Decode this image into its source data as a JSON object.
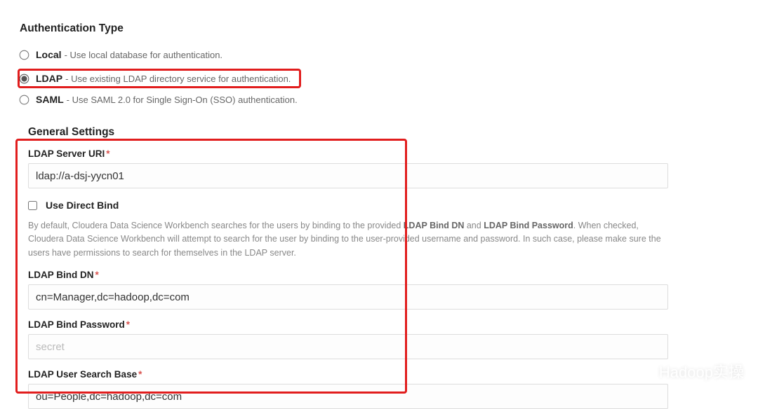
{
  "auth": {
    "title": "Authentication Type",
    "options": {
      "local": {
        "label": "Local",
        "desc": " - Use local database for authentication."
      },
      "ldap": {
        "label": "LDAP",
        "desc": " - Use existing LDAP directory service for authentication."
      },
      "saml": {
        "label": "SAML",
        "desc": " - Use SAML 2.0 for Single Sign-On (SSO) authentication."
      }
    },
    "selected": "ldap"
  },
  "general": {
    "title": "General Settings",
    "ldap_server_uri": {
      "label": "LDAP Server URI",
      "value": "ldap://a-dsj-yycn01",
      "required": true
    },
    "use_direct_bind": {
      "label": "Use Direct Bind",
      "checked": false
    },
    "help": {
      "p1": "By default, Cloudera Data Science Workbench searches for the users by binding to the provided ",
      "s1": "LDAP Bind DN",
      "p2": " and ",
      "s2": "LDAP Bind Password",
      "p3": ". When checked, Cloudera Data Science Workbench will attempt to search for the user by binding to the user-provided username and password. In such case, please make sure the users have permissions to search for themselves in the LDAP server."
    },
    "ldap_bind_dn": {
      "label": "LDAP Bind DN",
      "value": "cn=Manager,dc=hadoop,dc=com",
      "required": true
    },
    "ldap_bind_password": {
      "label": "LDAP Bind Password",
      "placeholder": "secret",
      "value": "",
      "required": true
    },
    "ldap_user_search_base": {
      "label": "LDAP User Search Base",
      "value": "ou=People,dc=hadoop,dc=com",
      "required": true
    }
  },
  "watermark": {
    "text": "Hadoop实操"
  },
  "required_marker": "*"
}
